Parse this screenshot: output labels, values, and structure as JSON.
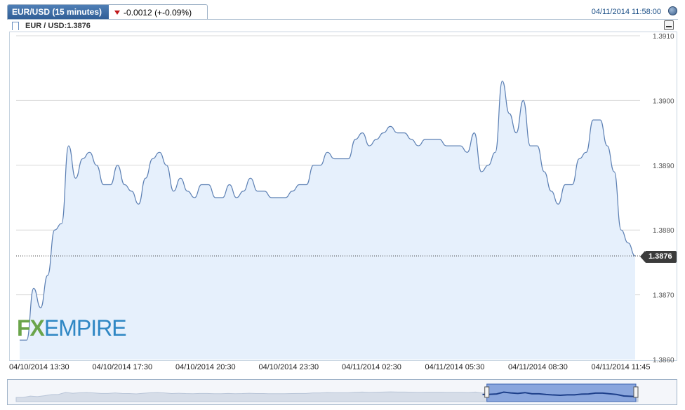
{
  "header": {
    "symbol_tab": "EUR/USD (15 minutes)",
    "change": "-0.0012 (+-0.09%)",
    "change_direction_icon": "down-triangle-icon",
    "timestamp": "04/11/2014 11:58:00"
  },
  "legend": {
    "label": "EUR / USD:1.3876"
  },
  "last_price_label": "1.3876",
  "logo": {
    "part1": "FX",
    "part2": "EMPIRE"
  },
  "colors": {
    "line": "#5b7fb3",
    "area": "#e6f0fc",
    "grid": "#d8d8d8",
    "tab": "#2f5d95",
    "down": "#c0181b",
    "navigator_selection": "#8aa6dd"
  },
  "chart_data": {
    "type": "area",
    "title": "EUR/USD (15 minutes)",
    "ylim": [
      1.386,
      1.391
    ],
    "yticks": [
      "1.3860",
      "1.3870",
      "1.3880",
      "1.3890",
      "1.3900",
      "1.3910"
    ],
    "xticks": [
      "04/10/2014 13:30",
      "04/10/2014 17:30",
      "04/10/2014 20:30",
      "04/10/2014 23:30",
      "04/11/2014 02:30",
      "04/11/2014 05:30",
      "04/11/2014 08:30",
      "04/11/2014 11:45"
    ],
    "last_value": 1.3876,
    "grid": true,
    "series": [
      {
        "name": "EUR / USD",
        "values": [
          1.3863,
          1.3863,
          1.3871,
          1.3868,
          1.3873,
          1.388,
          1.3881,
          1.3893,
          1.3888,
          1.3891,
          1.3892,
          1.389,
          1.3887,
          1.3887,
          1.389,
          1.3887,
          1.3886,
          1.3884,
          1.3888,
          1.3891,
          1.3892,
          1.389,
          1.3886,
          1.3888,
          1.3886,
          1.3885,
          1.3887,
          1.3887,
          1.3885,
          1.3885,
          1.3887,
          1.3885,
          1.3886,
          1.3888,
          1.3886,
          1.3886,
          1.3885,
          1.3885,
          1.3885,
          1.3886,
          1.3887,
          1.3887,
          1.389,
          1.389,
          1.3892,
          1.3891,
          1.3891,
          1.3891,
          1.3894,
          1.3895,
          1.3893,
          1.3894,
          1.3895,
          1.3896,
          1.3895,
          1.3895,
          1.3894,
          1.3893,
          1.3894,
          1.3894,
          1.3894,
          1.3893,
          1.3893,
          1.3893,
          1.3892,
          1.3895,
          1.3889,
          1.389,
          1.3892,
          1.3903,
          1.3898,
          1.3895,
          1.39,
          1.3893,
          1.3893,
          1.3889,
          1.3886,
          1.3884,
          1.3887,
          1.3887,
          1.3891,
          1.3892,
          1.3897,
          1.3897,
          1.3893,
          1.3889,
          1.388,
          1.3878,
          1.3876
        ]
      }
    ]
  }
}
